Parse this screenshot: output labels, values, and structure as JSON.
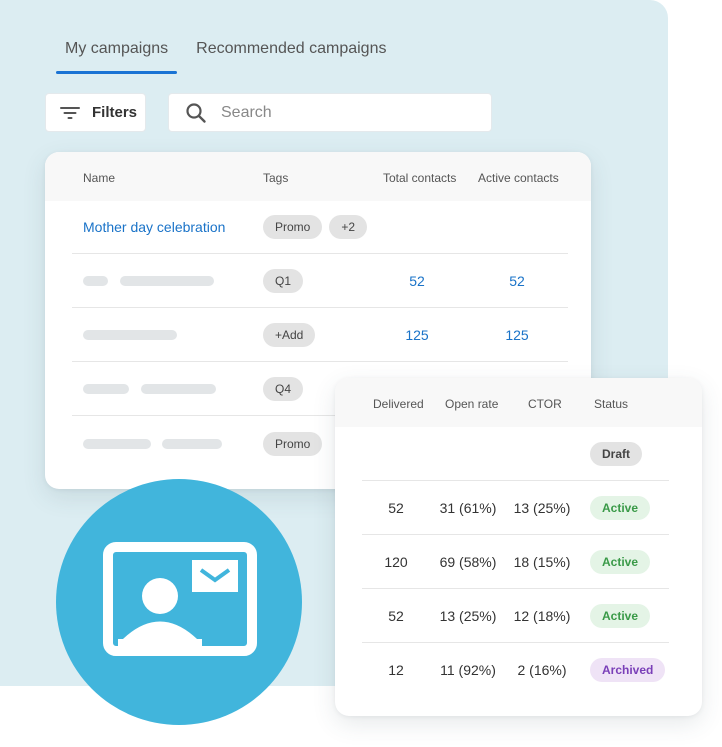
{
  "tabs": [
    {
      "label": "My campaigns",
      "active": true
    },
    {
      "label": "Recommended campaigns",
      "active": false
    }
  ],
  "toolbar": {
    "filters_label": "Filters",
    "filter_icon": "filter-icon",
    "search_icon": "search-icon",
    "search_placeholder": "Search",
    "search_value": ""
  },
  "campaigns_table": {
    "columns": [
      "Name",
      "Tags",
      "Total contacts",
      "Active contacts"
    ],
    "rows": [
      {
        "name": "Mother day celebration",
        "tags": [
          "Promo",
          "+2"
        ],
        "total_contacts": "",
        "active_contacts": ""
      },
      {
        "name": null,
        "tags": [
          "Q1"
        ],
        "total_contacts": "52",
        "active_contacts": "52"
      },
      {
        "name": null,
        "tags": [
          "+Add"
        ],
        "total_contacts": "125",
        "active_contacts": "125"
      },
      {
        "name": null,
        "tags": [
          "Q4"
        ],
        "total_contacts": "",
        "active_contacts": ""
      },
      {
        "name": null,
        "tags": [
          "Promo"
        ],
        "total_contacts": "",
        "active_contacts": ""
      }
    ]
  },
  "stats_table": {
    "columns": [
      "Delivered",
      "Open rate",
      "CTOR",
      "Status"
    ],
    "rows": [
      {
        "delivered": "",
        "open_rate": "",
        "ctor": "",
        "status": "Draft",
        "status_type": "draft"
      },
      {
        "delivered": "52",
        "open_rate": "31 (61%)",
        "ctor": "13 (25%)",
        "status": "Active",
        "status_type": "active"
      },
      {
        "delivered": "120",
        "open_rate": "69 (58%)",
        "ctor": "18 (15%)",
        "status": "Active",
        "status_type": "active"
      },
      {
        "delivered": "52",
        "open_rate": "13 (25%)",
        "ctor": "12 (18%)",
        "status": "Active",
        "status_type": "active"
      },
      {
        "delivered": "12",
        "open_rate": "11 (92%)",
        "ctor": "2 (16%)",
        "status": "Archived",
        "status_type": "archived"
      }
    ]
  },
  "illustration": {
    "icon": "contact-card-mail-icon"
  },
  "colors": {
    "accent": "#1a73d4",
    "link": "#1a73c8",
    "background_panel": "#dcedf2",
    "circle": "#41b5dc",
    "status_active_bg": "#e4f4e6",
    "status_active_text": "#3a9a48",
    "status_archived_bg": "#efe3f6",
    "status_archived_text": "#7a3fb8",
    "status_draft_bg": "#e3e3e3"
  }
}
